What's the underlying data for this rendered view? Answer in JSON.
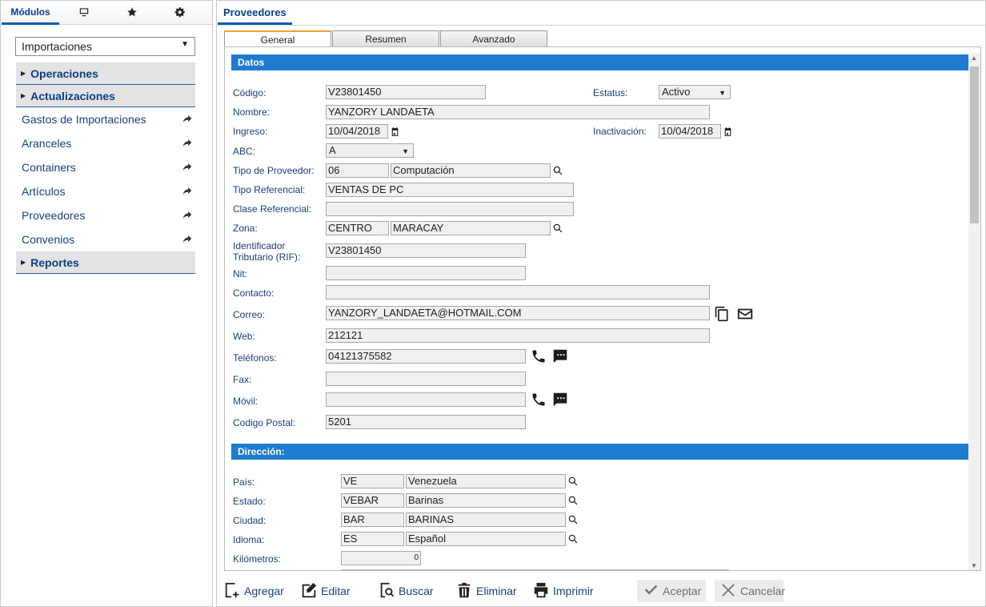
{
  "left": {
    "tabs": {
      "modules_label": "Módulos",
      "monitor_icon": "monitor-icon",
      "star_icon": "star-icon",
      "settings_icon": "settings-icon"
    },
    "module_select": "Importaciones",
    "sections": {
      "operaciones": "Operaciones",
      "actualizaciones": "Actualizaciones",
      "reportes": "Reportes"
    },
    "items": [
      {
        "label": "Gastos de Importaciones"
      },
      {
        "label": "Aranceles"
      },
      {
        "label": "Containers"
      },
      {
        "label": "Artículos"
      },
      {
        "label": "Proveedores"
      },
      {
        "label": "Convenios"
      }
    ]
  },
  "right": {
    "title": "Proveedores",
    "tabs": [
      "General",
      "Resumen",
      "Avanzado"
    ],
    "sections": {
      "datos": "Datos",
      "direccion": "Dirección:"
    },
    "labels": {
      "codigo": "Código:",
      "estatus": "Estatus:",
      "nombre": "Nombre:",
      "ingreso": "Ingreso:",
      "inactivacion": "Inactivación:",
      "abc": "ABC:",
      "tipo_proveedor": "Tipo de Proveedor:",
      "tipo_referencial": "Tipo Referencial:",
      "clase_referencial": "Clase Referencial:",
      "zona": "Zona:",
      "identificador_1": "Identificador",
      "identificador_2": "Tributario (RIF):",
      "nit": "Nit:",
      "contacto": "Contacto:",
      "correo": "Correo:",
      "web": "Web:",
      "telefonos": "Teléfonos:",
      "fax": "Fax:",
      "movil": "Móvil:",
      "codigo_postal": "Codigo Postal:",
      "pais": "País:",
      "estado": "Estado:",
      "ciudad": "Ciudad:",
      "idioma": "Idioma:",
      "kilometros": "Kilómetros:"
    },
    "values": {
      "codigo": "V23801450",
      "estatus": "Activo",
      "nombre": "YANZORY LANDAETA",
      "ingreso": "10/04/2018",
      "inactivacion": "10/04/2018",
      "abc": "A",
      "tipo_proveedor_code": "06",
      "tipo_proveedor_name": "Computación",
      "tipo_referencial": "VENTAS DE PC",
      "clase_referencial": "",
      "zona_code": "CENTRO",
      "zona_name": "MARACAY",
      "rif": "V23801450",
      "nit": "",
      "contacto": "",
      "correo": "YANZORY_LANDAETA@HOTMAIL.COM",
      "web": "212121",
      "telefonos": "04121375582",
      "fax": "",
      "movil": "",
      "codigo_postal": "5201",
      "pais_code": "VE",
      "pais_name": "Venezuela",
      "estado_code": "VEBAR",
      "estado_name": "Barinas",
      "ciudad_code": "BAR",
      "ciudad_name": "BARINAS",
      "idioma_code": "ES",
      "idioma_name": "Español",
      "kilometros": "0"
    }
  },
  "toolbar": {
    "agregar": "Agregar",
    "editar": "Editar",
    "buscar": "Buscar",
    "eliminar": "Eliminar",
    "imprimir": "Imprimir",
    "aceptar": "Aceptar",
    "cancelar": "Cancelar"
  },
  "colors": {
    "accent": "#1f7bd1",
    "nav_text": "#0b3d91"
  }
}
